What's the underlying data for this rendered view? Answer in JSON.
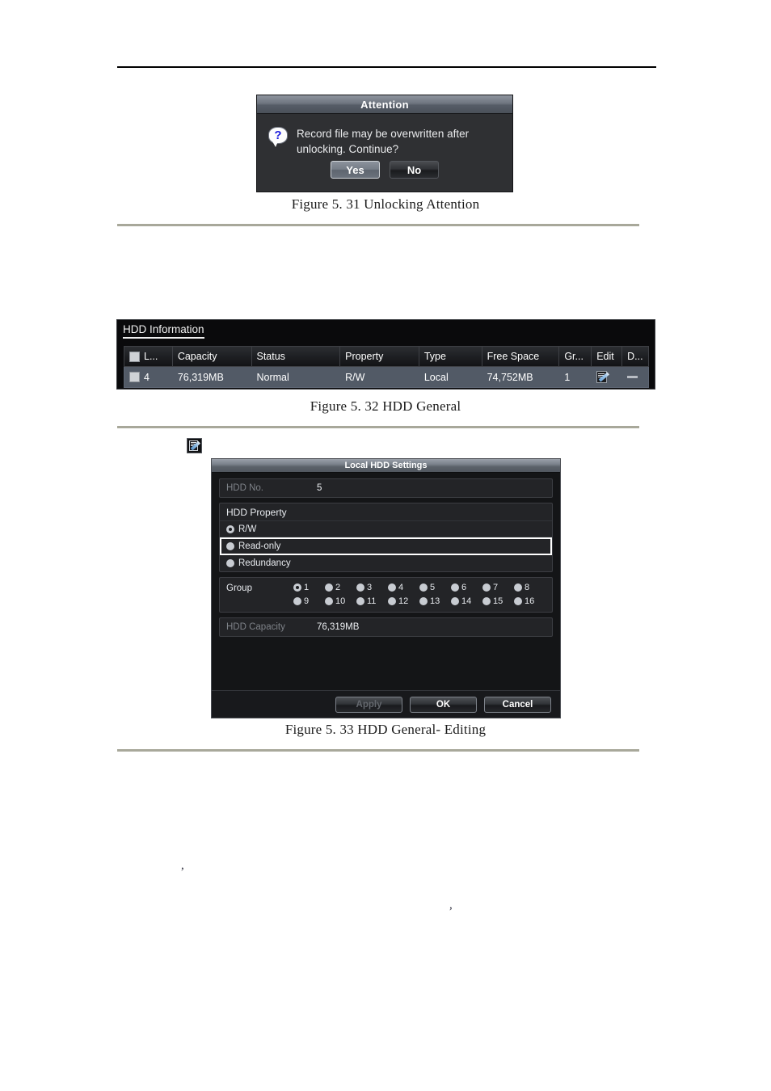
{
  "page": {
    "background": "#ffffff",
    "rule_color_top": "#000000",
    "rule_color_grey": "#a8a89a"
  },
  "attention_dialog": {
    "title": "Attention",
    "icon": "question-bubble-icon",
    "message": "Record file may be overwritten after unlocking. Continue?",
    "buttons": {
      "yes": "Yes",
      "no": "No"
    },
    "focused_button": "Yes"
  },
  "captions": {
    "fig_5_31": "Figure 5. 31 Unlocking Attention",
    "fig_5_32": "Figure 5. 32 HDD General",
    "fig_5_33": "Figure 5. 33 HDD General- Editing"
  },
  "stray_marks": {
    "comma_left": ",",
    "comma_right": ","
  },
  "hdd_information": {
    "panel_title": "HDD Information",
    "columns": [
      "L...",
      "Capacity",
      "Status",
      "Property",
      "Type",
      "Free Space",
      "Gr...",
      "Edit",
      "D..."
    ],
    "rows": [
      {
        "checkbox": "unchecked",
        "label": "4",
        "capacity": "76,319MB",
        "status": "Normal",
        "property": "R/W",
        "type": "Local",
        "free_space": "74,752MB",
        "group": "1",
        "edit_icon": "edit-pencil-icon",
        "delete_icon": "dash-icon",
        "selected": true
      }
    ],
    "row_highlight_color": "#525a66"
  },
  "standalone_edit_icon": {
    "name": "edit-pencil-icon"
  },
  "local_hdd_settings": {
    "title": "Local HDD Settings",
    "hdd_no": {
      "label": "HDD No.",
      "value": "5"
    },
    "hdd_property": {
      "label": "HDD Property",
      "options": [
        {
          "label": "R/W",
          "selected": true,
          "focused": false
        },
        {
          "label": "Read-only",
          "selected": false,
          "focused": true
        },
        {
          "label": "Redundancy",
          "selected": false,
          "focused": false
        }
      ]
    },
    "group": {
      "label": "Group",
      "selected": "1",
      "row1": [
        "1",
        "2",
        "3",
        "4",
        "5",
        "6",
        "7",
        "8"
      ],
      "row2": [
        "9",
        "10",
        "11",
        "12",
        "13",
        "14",
        "15",
        "16"
      ]
    },
    "hdd_capacity": {
      "label": "HDD Capacity",
      "value": "76,319MB"
    },
    "buttons": {
      "apply": "Apply",
      "ok": "OK",
      "cancel": "Cancel"
    },
    "apply_disabled": true
  }
}
